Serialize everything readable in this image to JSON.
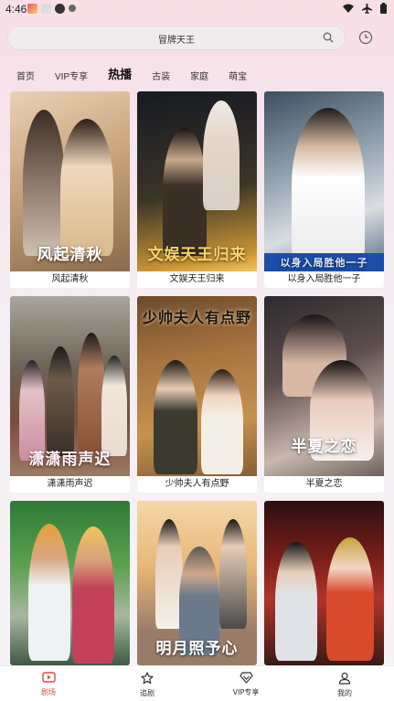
{
  "status": {
    "time": "4:46"
  },
  "search": {
    "placeholder": "冒牌天王"
  },
  "tabs": [
    {
      "label": "首页"
    },
    {
      "label": "VIP专享"
    },
    {
      "label": "热播"
    },
    {
      "label": "古装"
    },
    {
      "label": "家庭"
    },
    {
      "label": "萌宝"
    }
  ],
  "dramas": [
    {
      "title": "风起清秋",
      "poster_text": "风起清秋"
    },
    {
      "title": "文娱天王归来",
      "poster_text": "文娱天王归来"
    },
    {
      "title": "以身入局胜他一子",
      "poster_text": "以身入局胜他一子"
    },
    {
      "title": "潇潇雨声迟",
      "poster_text": "潇潇雨声迟"
    },
    {
      "title": "少帅夫人有点野",
      "poster_text": "少帅夫人有点野"
    },
    {
      "title": "半夏之恋",
      "poster_text": "半夏之恋"
    },
    {
      "title": "",
      "poster_text": ""
    },
    {
      "title": "",
      "poster_text": "明月照予心"
    },
    {
      "title": "",
      "poster_text": ""
    }
  ],
  "nav": [
    {
      "label": "剧场"
    },
    {
      "label": "追剧"
    },
    {
      "label": "VIP专享"
    },
    {
      "label": "我的"
    }
  ],
  "colors": {
    "accent": "#e0473c",
    "bg_top": "#f7dfe6"
  }
}
